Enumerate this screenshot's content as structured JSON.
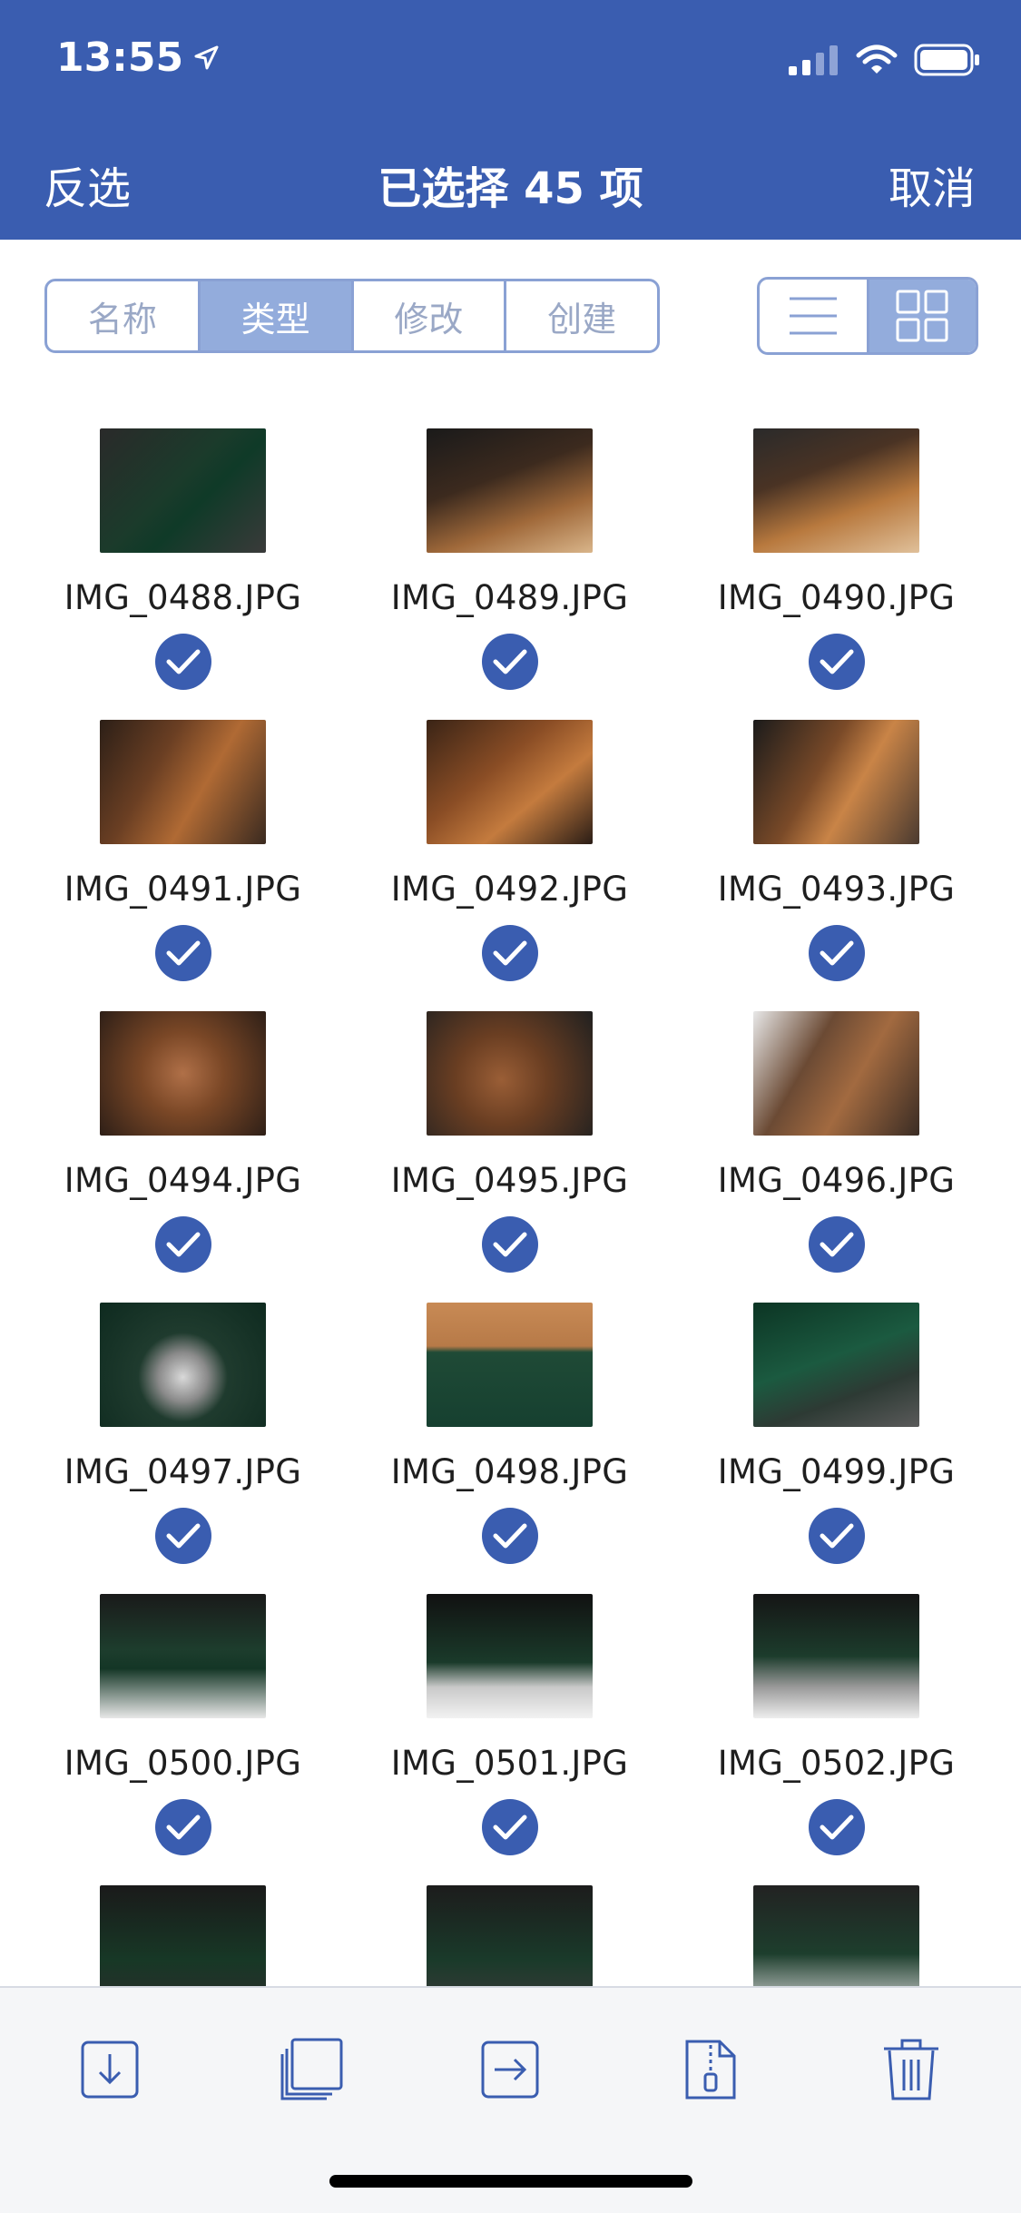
{
  "status": {
    "time": "13:55"
  },
  "nav": {
    "left": "反选",
    "title": "已选择 45 项",
    "right": "取消"
  },
  "sort_tabs": [
    {
      "label": "名称",
      "active": false
    },
    {
      "label": "类型",
      "active": true
    },
    {
      "label": "修改",
      "active": false
    },
    {
      "label": "创建",
      "active": false
    }
  ],
  "view_modes": [
    "list-icon",
    "grid-icon"
  ],
  "view_active": "grid",
  "files": [
    {
      "name": "IMG_0488.JPG",
      "selected": true
    },
    {
      "name": "IMG_0489.JPG",
      "selected": true
    },
    {
      "name": "IMG_0490.JPG",
      "selected": true
    },
    {
      "name": "IMG_0491.JPG",
      "selected": true
    },
    {
      "name": "IMG_0492.JPG",
      "selected": true
    },
    {
      "name": "IMG_0493.JPG",
      "selected": true
    },
    {
      "name": "IMG_0494.JPG",
      "selected": true
    },
    {
      "name": "IMG_0495.JPG",
      "selected": true
    },
    {
      "name": "IMG_0496.JPG",
      "selected": true
    },
    {
      "name": "IMG_0497.JPG",
      "selected": true
    },
    {
      "name": "IMG_0498.JPG",
      "selected": true
    },
    {
      "name": "IMG_0499.JPG",
      "selected": true
    },
    {
      "name": "IMG_0500.JPG",
      "selected": true
    },
    {
      "name": "IMG_0501.JPG",
      "selected": true
    },
    {
      "name": "IMG_0502.JPG",
      "selected": true
    }
  ],
  "toolbar": [
    "download-icon",
    "copy-icon",
    "move-icon",
    "zip-icon",
    "trash-icon"
  ],
  "colors": {
    "accent": "#3a5db0",
    "segment_active": "#93acdc",
    "segment_border": "#8aa1d4"
  }
}
